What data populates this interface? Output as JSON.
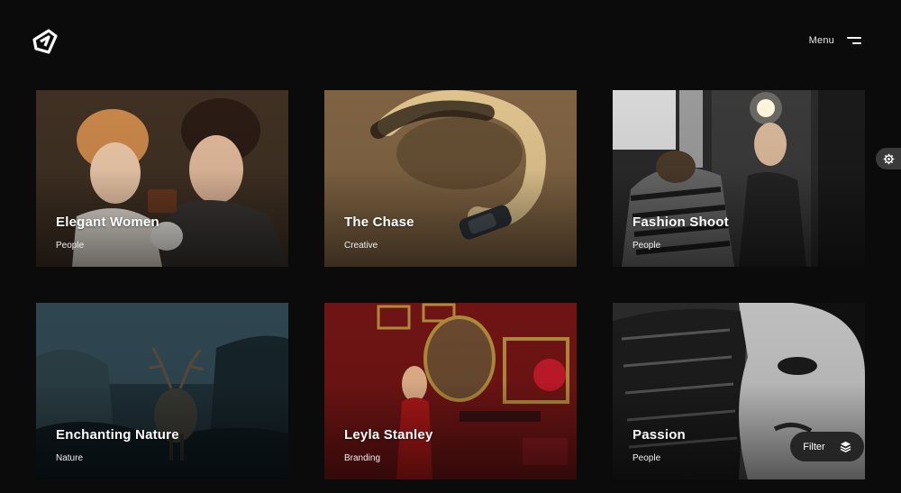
{
  "header": {
    "logo_icon": "stylized-j-logo",
    "menu_label": "Menu",
    "menu_icon": "hamburger-icon"
  },
  "portfolio": {
    "items": [
      {
        "title": "Elegant Women",
        "category": "People"
      },
      {
        "title": "The Chase",
        "category": "Creative"
      },
      {
        "title": "Fashion Shoot",
        "category": "People"
      },
      {
        "title": "Enchanting Nature",
        "category": "Nature"
      },
      {
        "title": "Leyla Stanley",
        "category": "Branding"
      },
      {
        "title": "Passion",
        "category": "People"
      }
    ]
  },
  "settings_tab": {
    "icon": "gear-icon"
  },
  "filter": {
    "label": "Filter",
    "icon": "layers-icon"
  },
  "colors": {
    "background": "#0b0b0b",
    "text": "#ffffff",
    "pill": "#1e1e1e"
  }
}
